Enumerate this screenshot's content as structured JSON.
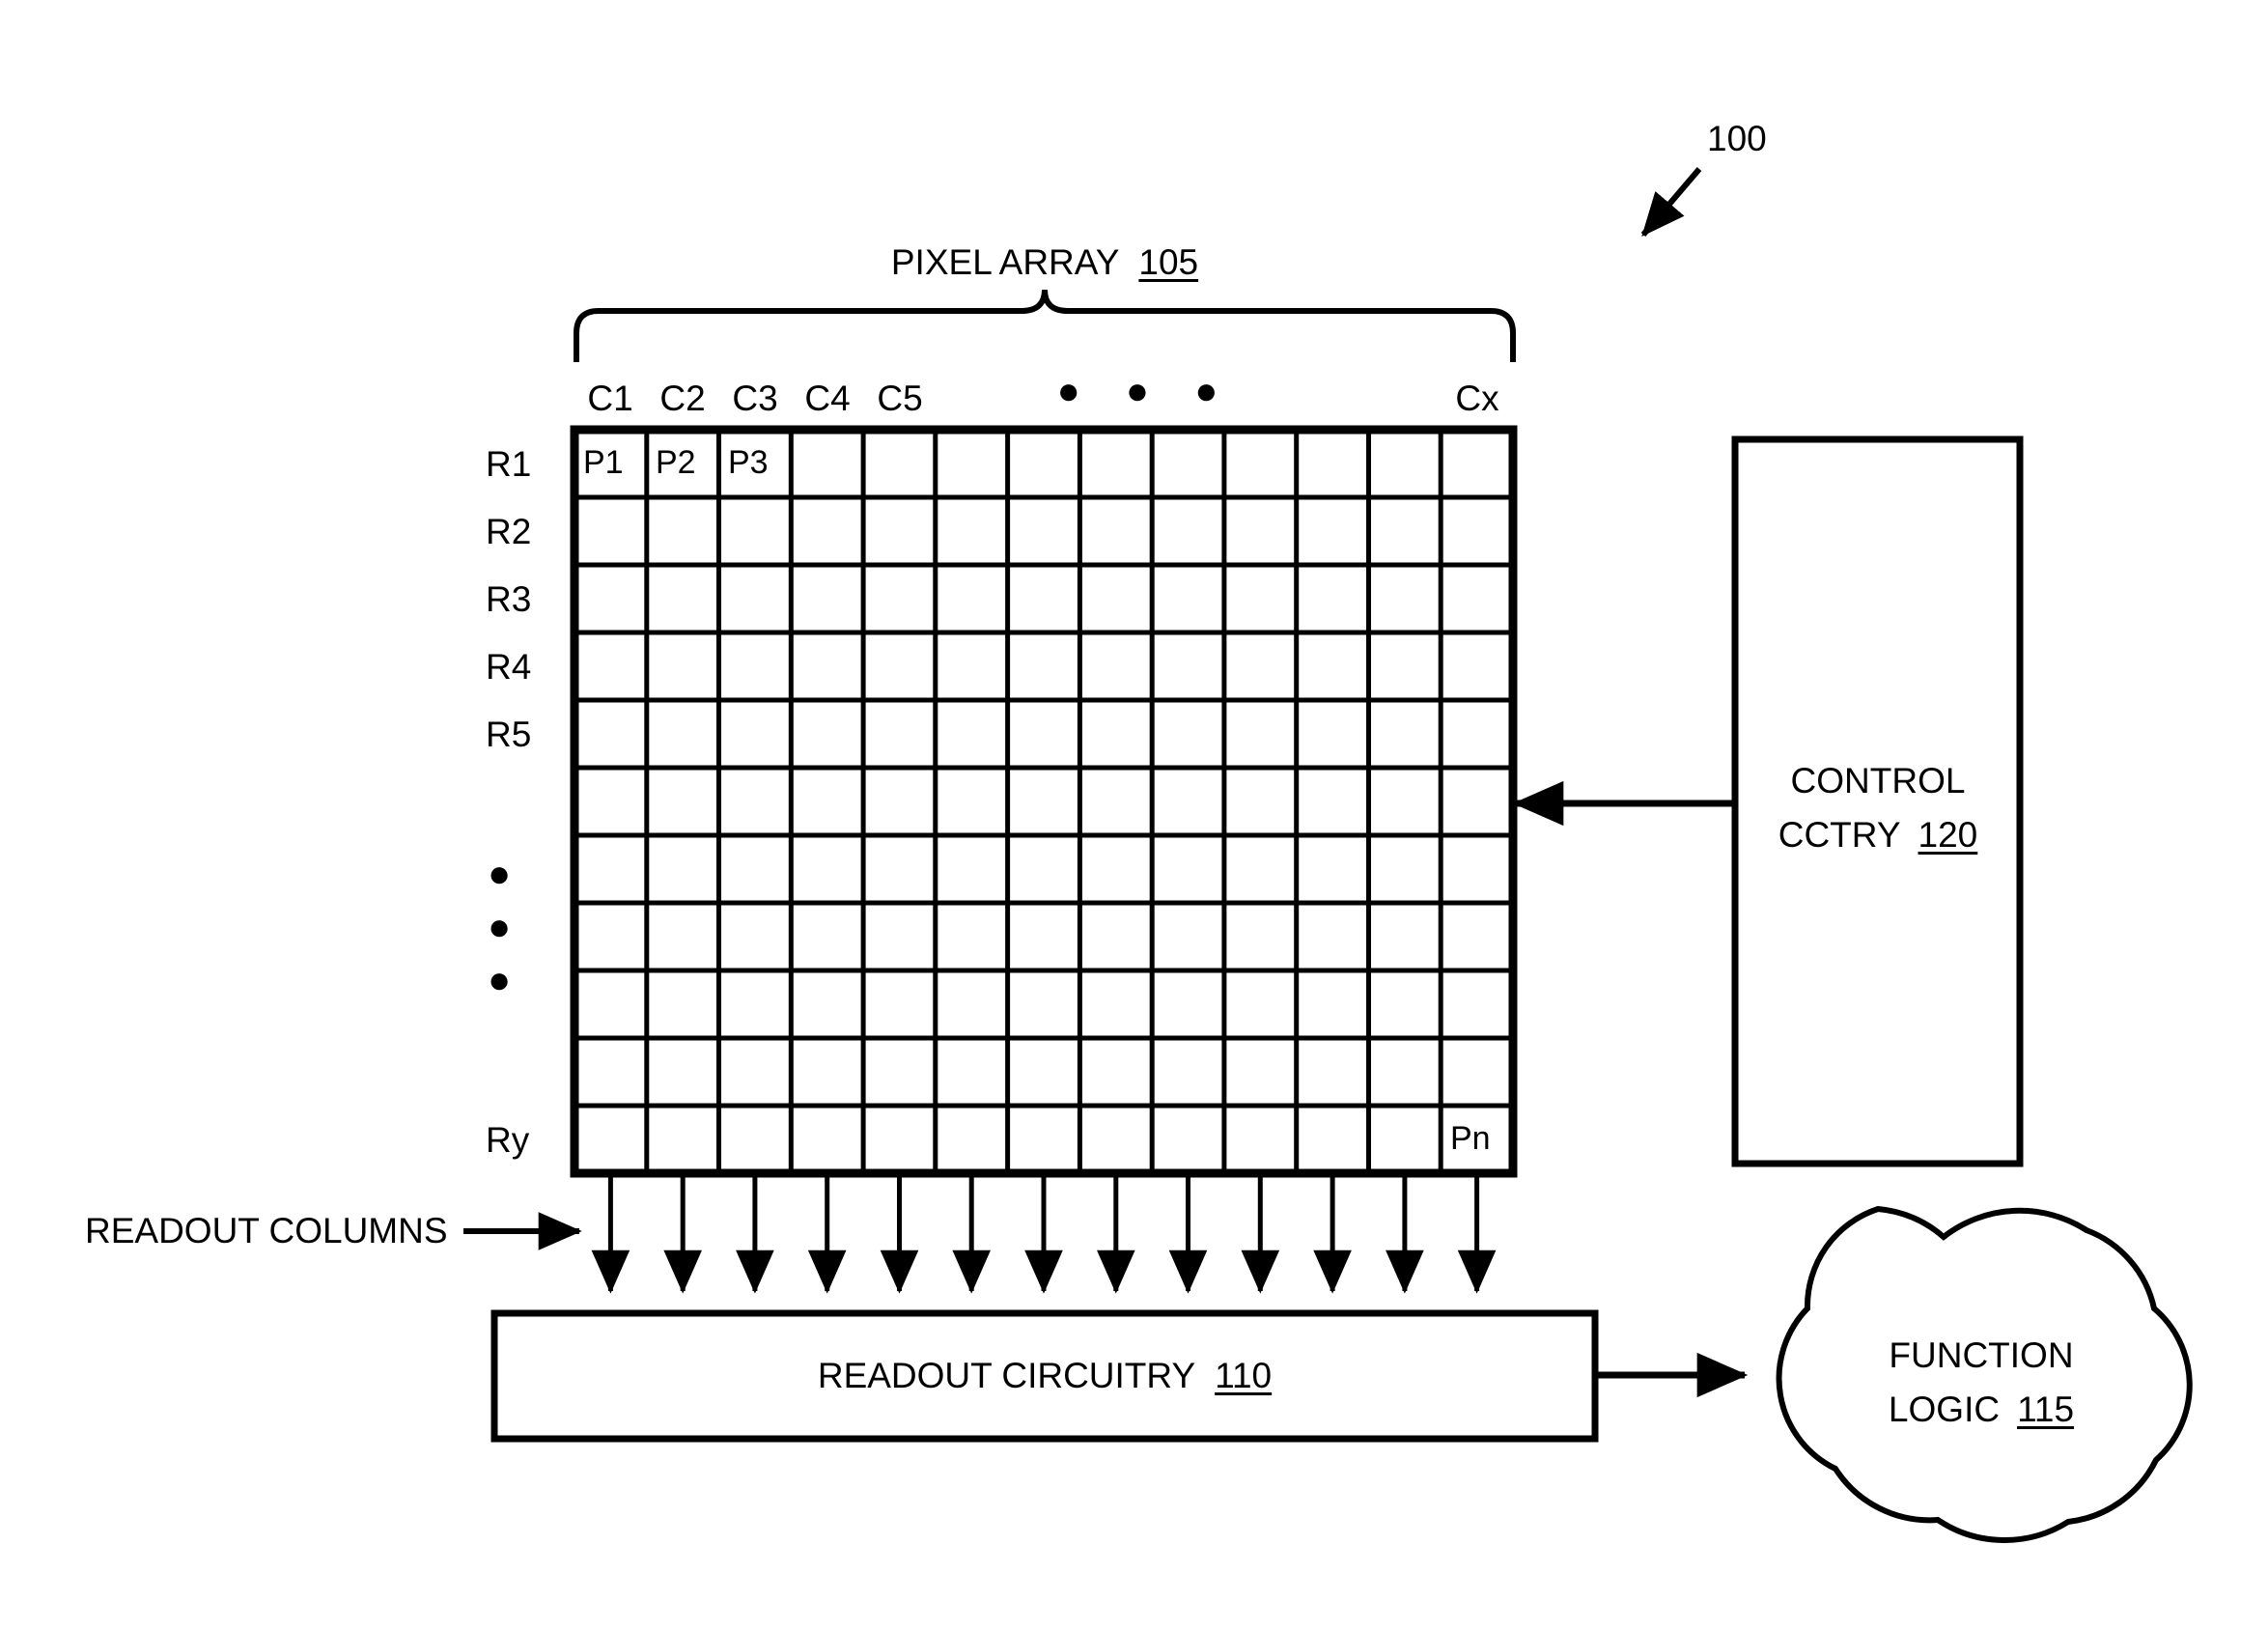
{
  "figure": {
    "reference_numeral": "100",
    "pixel_array": {
      "title": "PIXEL ARRAY",
      "ref": "105",
      "column_labels": [
        "C1",
        "C2",
        "C3",
        "C4",
        "C5",
        "Cx"
      ],
      "column_ellipsis": "● ● ●",
      "row_labels": [
        "R1",
        "R2",
        "R3",
        "R4",
        "R5",
        "Ry"
      ],
      "row_ellipsis": "●",
      "grid_columns": 13,
      "grid_rows": 11,
      "pixel_cells": [
        {
          "label": "P1",
          "row": 1,
          "col": 1
        },
        {
          "label": "P2",
          "row": 1,
          "col": 2
        },
        {
          "label": "P3",
          "row": 1,
          "col": 3
        },
        {
          "label": "Pn",
          "row": 11,
          "col": 13
        }
      ]
    },
    "readout_columns_label": "READOUT COLUMNS",
    "readout_circuitry": {
      "title": "READOUT CIRCUITRY",
      "ref": "110"
    },
    "function_logic": {
      "line1": "FUNCTION",
      "line2": "LOGIC",
      "ref": "115"
    },
    "control_circuitry": {
      "line1": "CONTROL",
      "line2": "CCTRY",
      "ref": "120"
    }
  },
  "colors": {
    "ink": "#000000",
    "paper": "#ffffff"
  }
}
